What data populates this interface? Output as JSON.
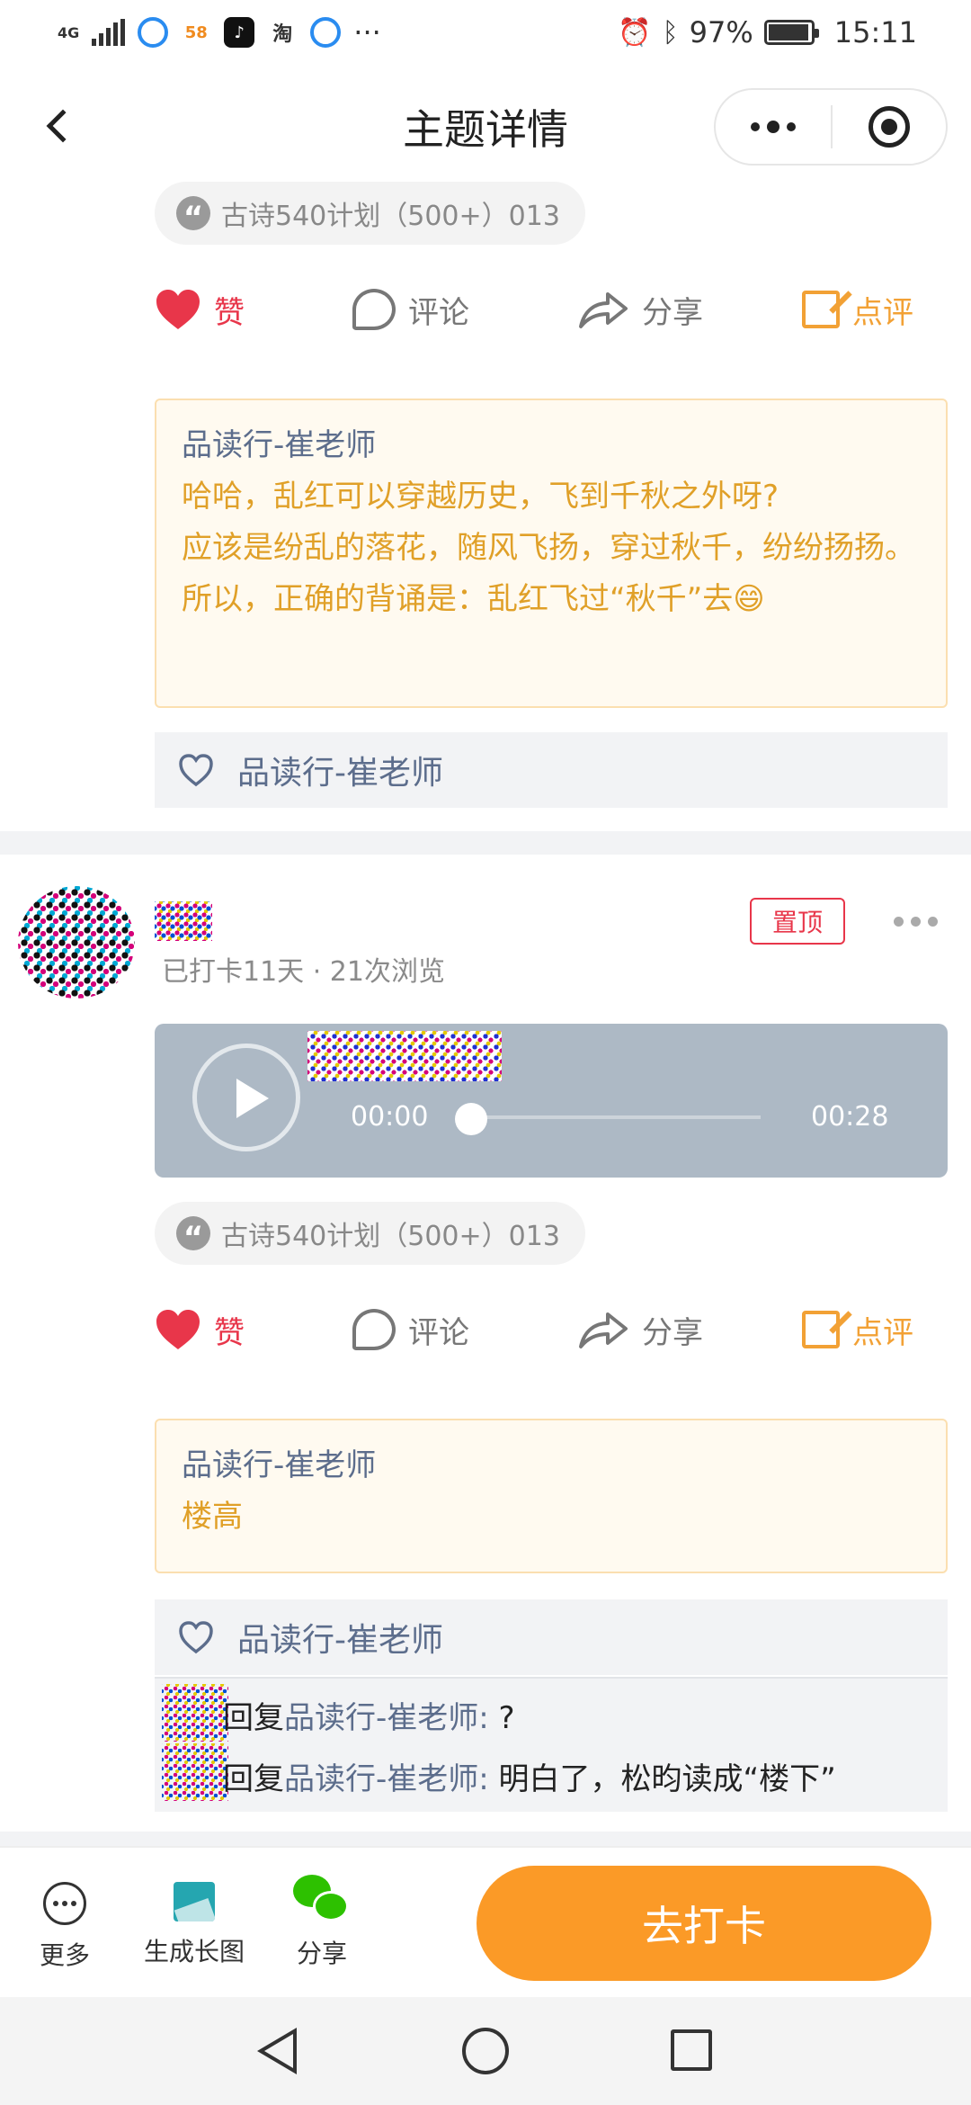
{
  "status_bar": {
    "network": "4G",
    "app_58": "58",
    "app_taobao": "淘",
    "more": "···",
    "battery": "97%",
    "battery_level": 0.97,
    "time": "15:11"
  },
  "header": {
    "title": "主题详情"
  },
  "colors": {
    "accent_orange": "#fb9a27",
    "like_red": "#e8364a",
    "review_orange": "#f2a135",
    "name_blue": "#5c6d8c"
  },
  "posts": [
    {
      "topic": "古诗540计划（500+）013",
      "actions": {
        "like": "赞",
        "comment": "评论",
        "share": "分享",
        "review": "点评"
      },
      "review": {
        "author": "品读行-崔老师",
        "text": "哈哈，乱红可以穿越历史，飞到千秋之外呀?\n应该是纷乱的落花，随风飞扬，穿过秋千，纷纷扬扬。\n所以，正确的背诵是：乱红飞过“秋千”去😄"
      },
      "liked_by": "品读行-崔老师"
    },
    {
      "pin_label": "置顶",
      "meta": "已打卡11天 · 21次浏览",
      "audio": {
        "current": "00:00",
        "total": "00:28",
        "progress": 0.0
      },
      "topic": "古诗540计划（500+）013",
      "actions": {
        "like": "赞",
        "comment": "评论",
        "share": "分享",
        "review": "点评"
      },
      "review": {
        "author": "品读行-崔老师",
        "text": "楼高"
      },
      "liked_by": "品读行-崔老师",
      "replies": [
        {
          "prefix": "回复",
          "to": "品读行-崔老师",
          "colon": ": ",
          "text": "?"
        },
        {
          "prefix": "回复",
          "to": "品读行-崔老师",
          "colon": ": ",
          "text": "明白了，松昀读成“楼下”"
        }
      ]
    }
  ],
  "bottom_bar": {
    "more": "更多",
    "long_image": "生成长图",
    "share": "分享",
    "checkin": "去打卡"
  },
  "icons": {
    "back": "chevron-left-icon",
    "capsule_more": "more-dots-icon",
    "capsule_close": "target-icon",
    "quote": "quote-icon",
    "like": "heart-icon",
    "comment": "speech-bubble-icon",
    "share": "share-arrow-icon",
    "review": "edit-icon"
  }
}
